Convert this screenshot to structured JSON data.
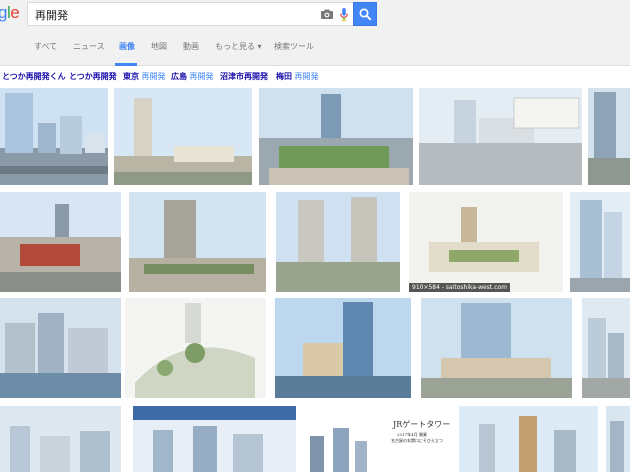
{
  "logo": {
    "part1": "g",
    "part2": "l",
    "part3": "e"
  },
  "search": {
    "query": "再開発"
  },
  "colors": {
    "accent": "#4285f4",
    "link": "#1a0dab",
    "header_bg": "#f1f1f1"
  },
  "icons": {
    "camera": "camera-icon",
    "mic": "mic-icon",
    "search": "search-icon"
  },
  "tabs": [
    {
      "label": "すべて"
    },
    {
      "label": "ニュース"
    },
    {
      "label": "画像"
    },
    {
      "label": "地図"
    },
    {
      "label": "動画"
    },
    {
      "label": "もっと見る ▾"
    },
    {
      "label": "検索ツール"
    }
  ],
  "related": [
    {
      "main": "とつか再開発くん",
      "sub": ""
    },
    {
      "main": "とつか再開発",
      "sub": ""
    },
    {
      "main": "東京",
      "sub": " 再開発"
    },
    {
      "main": "広島",
      "sub": " 再開発"
    },
    {
      "main": "沼津市再開発",
      "sub": ""
    },
    {
      "main": "梅田",
      "sub": " 再開発"
    }
  ],
  "thumb_texts": {
    "hover_caption": "910×584 - saitoshika-west.com",
    "jr_title": "JRゲートタワー",
    "jr_sub1": "2017年4月 開業",
    "jr_sub2": "名古屋の玄関口にそびえ立つ"
  }
}
